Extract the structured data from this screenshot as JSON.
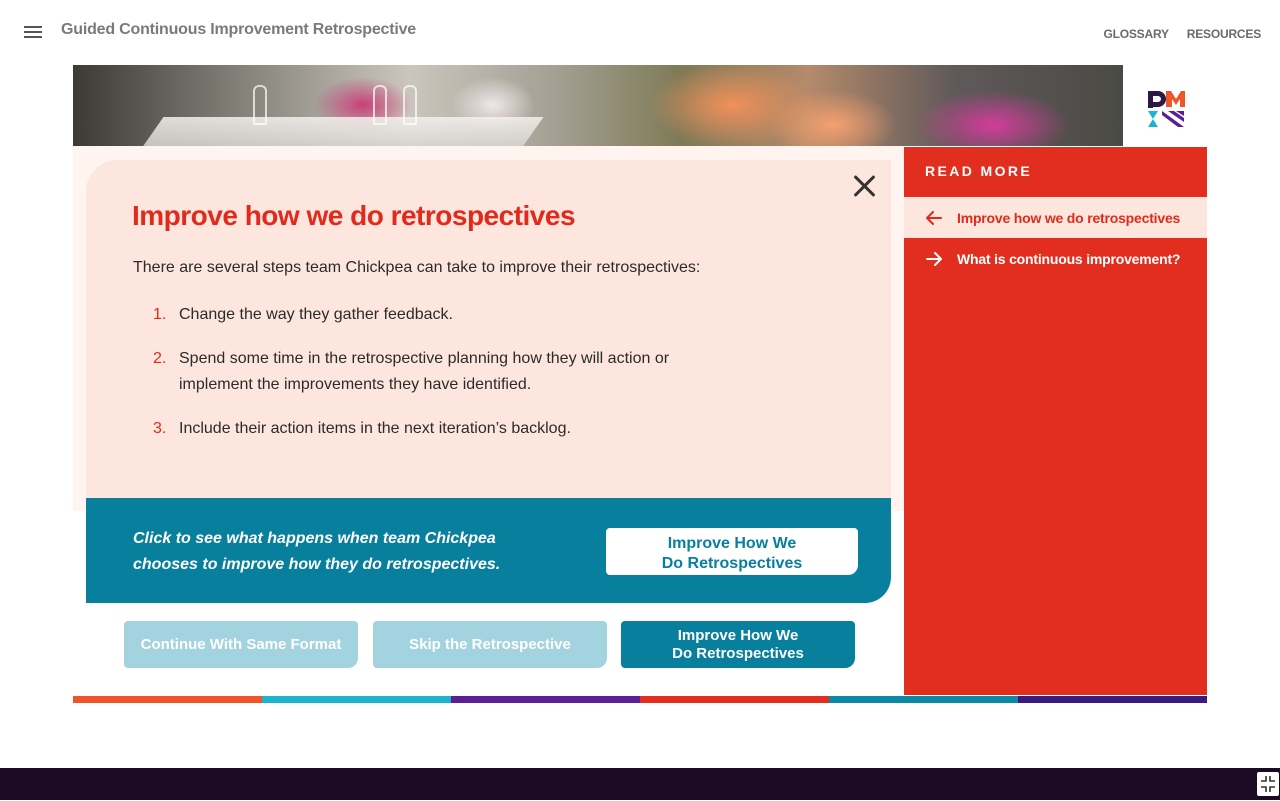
{
  "header": {
    "title": "Guided Continuous Improvement Retrospective",
    "nav": [
      "GLOSSARY",
      "RESOURCES"
    ]
  },
  "modal": {
    "title": "Improve how we do retrospectives",
    "intro": "There are several steps team Chickpea can take to improve their retrospectives:",
    "steps": [
      {
        "num": "1.",
        "text": "Change the way they gather feedback."
      },
      {
        "num": "2.",
        "text": "Spend some time in the retrospective planning how they will action or implement the improvements they have identified."
      },
      {
        "num": "3.",
        "text": "Include their action items in the next iteration’s backlog."
      }
    ],
    "cta_text": "Click to see what happens when team Chickpea chooses to improve how they do retrospectives.",
    "cta_button_line1": "Improve How We",
    "cta_button_line2": "Do Retrospectives"
  },
  "choices": [
    {
      "label": "Continue With Same Format",
      "state": "disabled"
    },
    {
      "label": "Skip the Retrospective",
      "state": "disabled"
    },
    {
      "label_line1": "Improve How We",
      "label_line2": "Do Retrospectives",
      "state": "active"
    }
  ],
  "read_more": {
    "heading": "READ MORE",
    "items": [
      {
        "label": "Improve how we do retrospectives",
        "icon": "arrow-left-icon",
        "active": true
      },
      {
        "label": "What is continuous improvement?",
        "icon": "arrow-right-icon",
        "active": false
      }
    ]
  },
  "colors": {
    "accent_red": "#e22a1c",
    "teal": "#087f9d",
    "light_teal": "#a4d3e0",
    "modal_bg": "#fde6dd",
    "footer": "#1a0a24",
    "stripes": [
      "#f0552a",
      "#1bb3d0",
      "#5a1e96",
      "#e22e1e",
      "#0a8aa6",
      "#3a1a80"
    ]
  }
}
